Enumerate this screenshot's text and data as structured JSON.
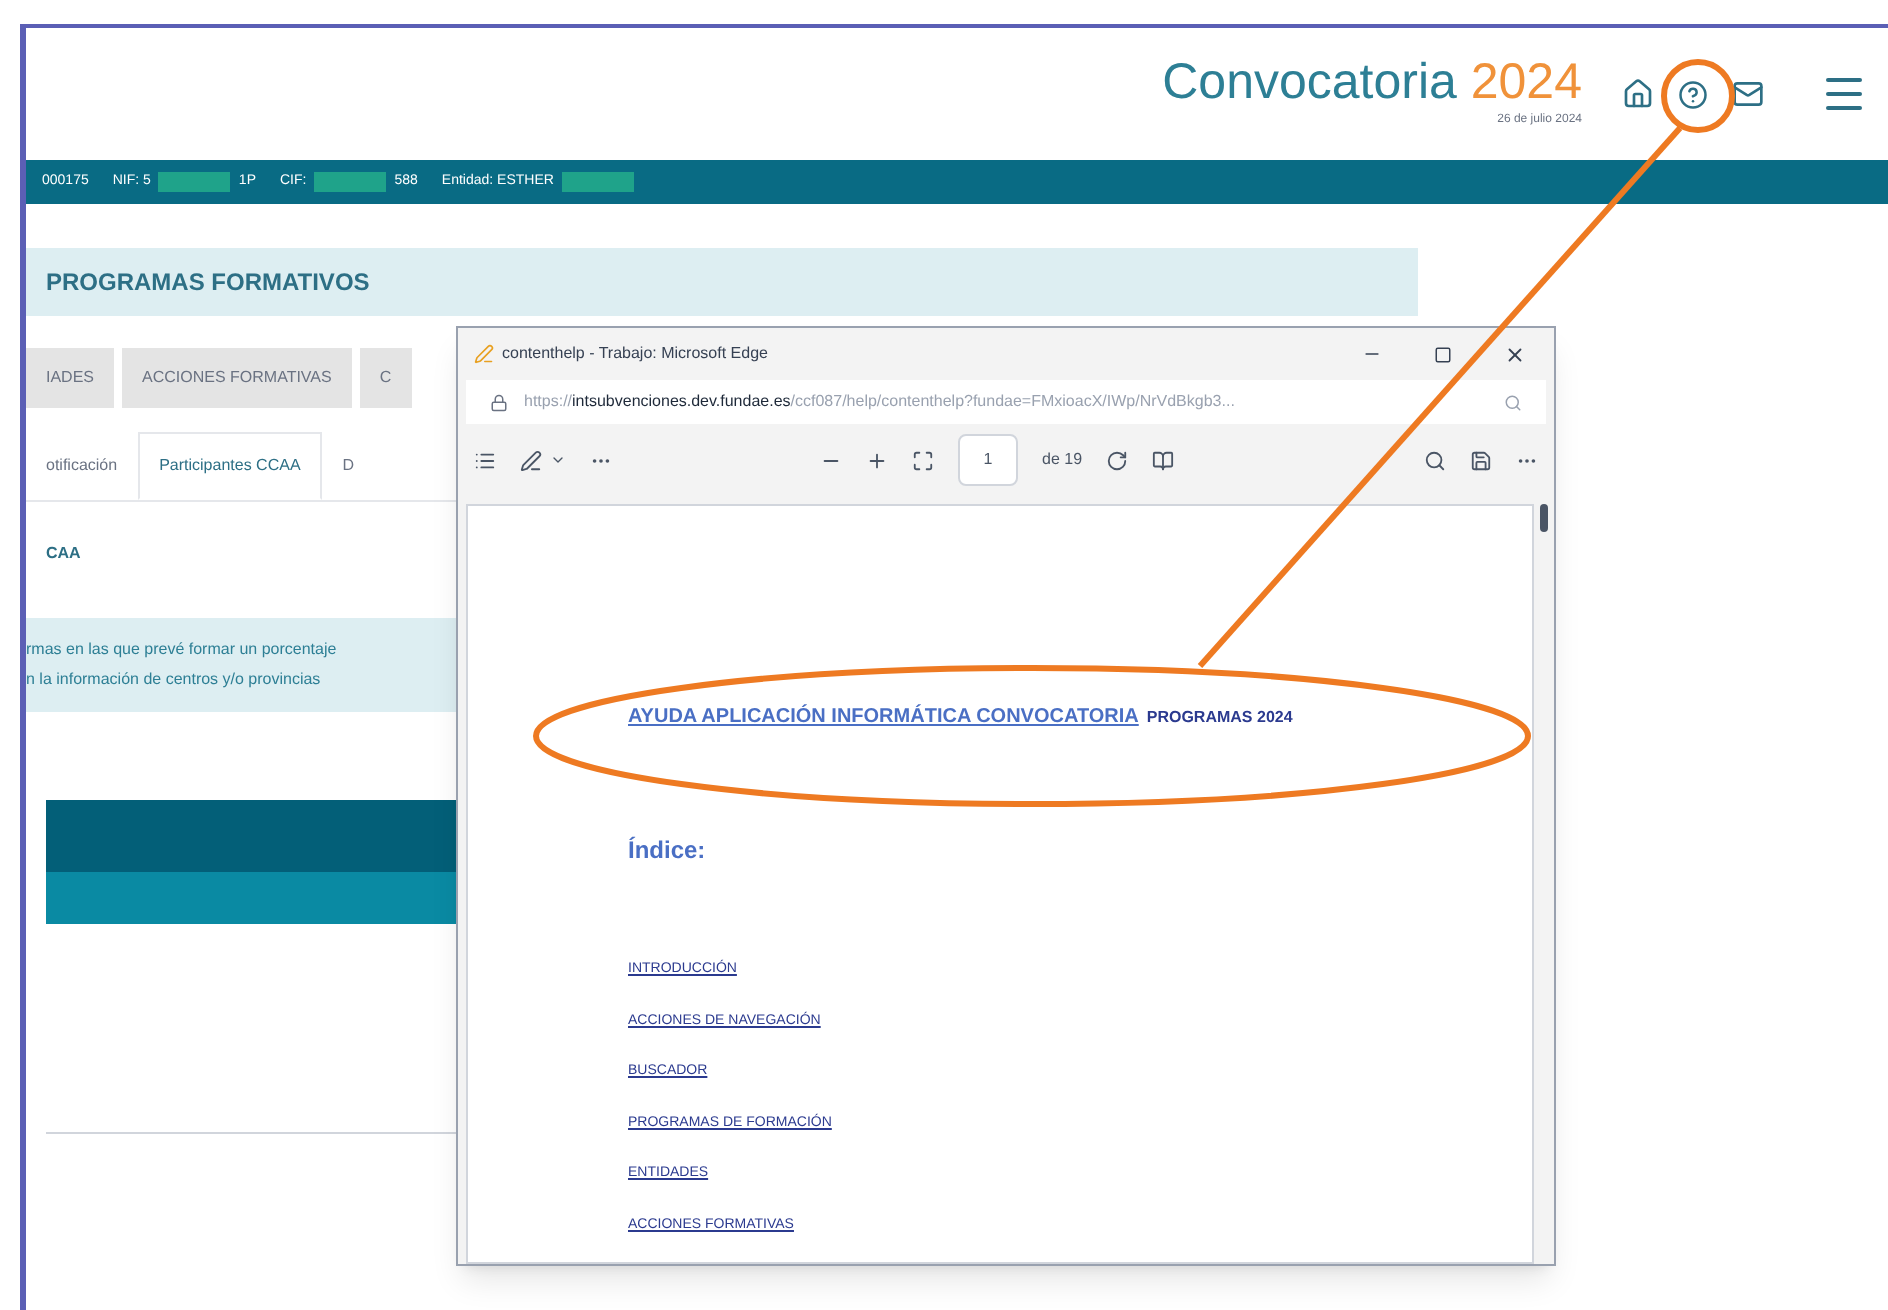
{
  "header": {
    "title": "Convocatoria",
    "year": "2024",
    "date": "26 de julio 2024"
  },
  "info_bar": [
    {
      "kind": "text",
      "text": "000175"
    },
    {
      "kind": "text",
      "text": "NIF: 5"
    },
    {
      "kind": "redacted"
    },
    {
      "kind": "text",
      "text": "1P"
    },
    {
      "kind": "text",
      "text": "CIF:"
    },
    {
      "kind": "redacted"
    },
    {
      "kind": "text",
      "text": "588"
    },
    {
      "kind": "text",
      "text": "Entidad: ESTHER"
    },
    {
      "kind": "redacted"
    }
  ],
  "section_title": "PROGRAMAS FORMATIVOS",
  "tabs": [
    {
      "label": "IADES",
      "selected": false
    },
    {
      "label": "ACCIONES FORMATIVAS",
      "selected": false
    },
    {
      "label": "C",
      "selected": false
    }
  ],
  "subtabs": [
    {
      "label": "otificación",
      "selected": false
    },
    {
      "label": "Participantes CCAA",
      "selected": true
    },
    {
      "label": "D",
      "selected": false
    }
  ],
  "subheading": "CAA",
  "info_lines": [
    "rmas en las que prevé formar un porcentaje",
    "n la información de centros y/o provincias"
  ],
  "popup": {
    "title": "contenthelp - Trabajo: Microsoft Edge",
    "url_prefix": "https://",
    "url_host": "intsubvenciones.dev.fundae.es",
    "url_path": "/ccf087/help/contenthelp?fundae=FMxioacX/IWp/NrVdBkgb3...",
    "page": "1",
    "page_total": "de 19",
    "doc_title": "AYUDA APLICACIÓN INFORMÁTICA CONVOCATORIA",
    "doc_title_extra": "PROGRAMAS 2024",
    "index_heading": "Índice:",
    "index_links": [
      "INTRODUCCIÓN",
      "ACCIONES DE NAVEGACIÓN",
      "BUSCADOR",
      "PROGRAMAS DE FORMACIÓN",
      "ENTIDADES",
      "ACCIONES FORMATIVAS"
    ]
  }
}
